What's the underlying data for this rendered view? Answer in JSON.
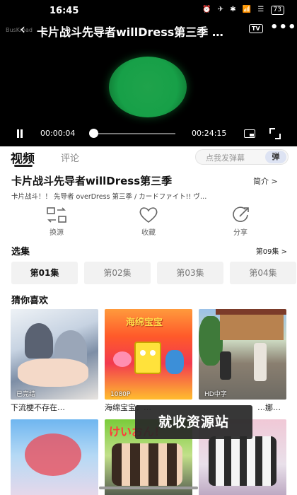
{
  "status_bar": {
    "time": "16:45",
    "icons": "⏰ ✈ ✱ 📶 ☰",
    "battery": "73"
  },
  "player": {
    "back_icon": "‹",
    "title": "卡片战斗先导者willDress第三季 …",
    "watermark": "BusKroad",
    "tv_label": "TV",
    "more_icon": "•••",
    "current_time": "00:00:04",
    "duration": "00:24:15",
    "progress": 0.003
  },
  "tabs": {
    "video": "视频",
    "comment": "评论"
  },
  "danmu": {
    "placeholder": "点我发弹幕",
    "button": "弹"
  },
  "video": {
    "title": "卡片战斗先导者willDress第三季",
    "intro_label": "简介 >",
    "description": "卡片战斗！！ 先导者 overDress 第三季 / カードファイト!! ヴ…"
  },
  "actions": [
    {
      "label": "换源",
      "icon": "switch-source-icon"
    },
    {
      "label": "收藏",
      "icon": "heart-icon"
    },
    {
      "label": "分享",
      "icon": "share-icon"
    }
  ],
  "episodes": {
    "heading": "选集",
    "count_label": "第09集 >",
    "items": [
      "第01集",
      "第02集",
      "第03集",
      "第04集"
    ],
    "selected": 0
  },
  "recommend": {
    "heading": "猜你喜欢",
    "items": [
      {
        "tag": "已完结",
        "caption": "下流梗不存在…"
      },
      {
        "tag": "1080P",
        "caption": "海绵宝宝：…"
      },
      {
        "tag": "HD中字",
        "caption": "…娜…"
      },
      {
        "tag": "",
        "caption": ""
      },
      {
        "tag": "",
        "caption": ""
      },
      {
        "tag": "",
        "caption": ""
      }
    ]
  },
  "overlay": "就收资源站"
}
